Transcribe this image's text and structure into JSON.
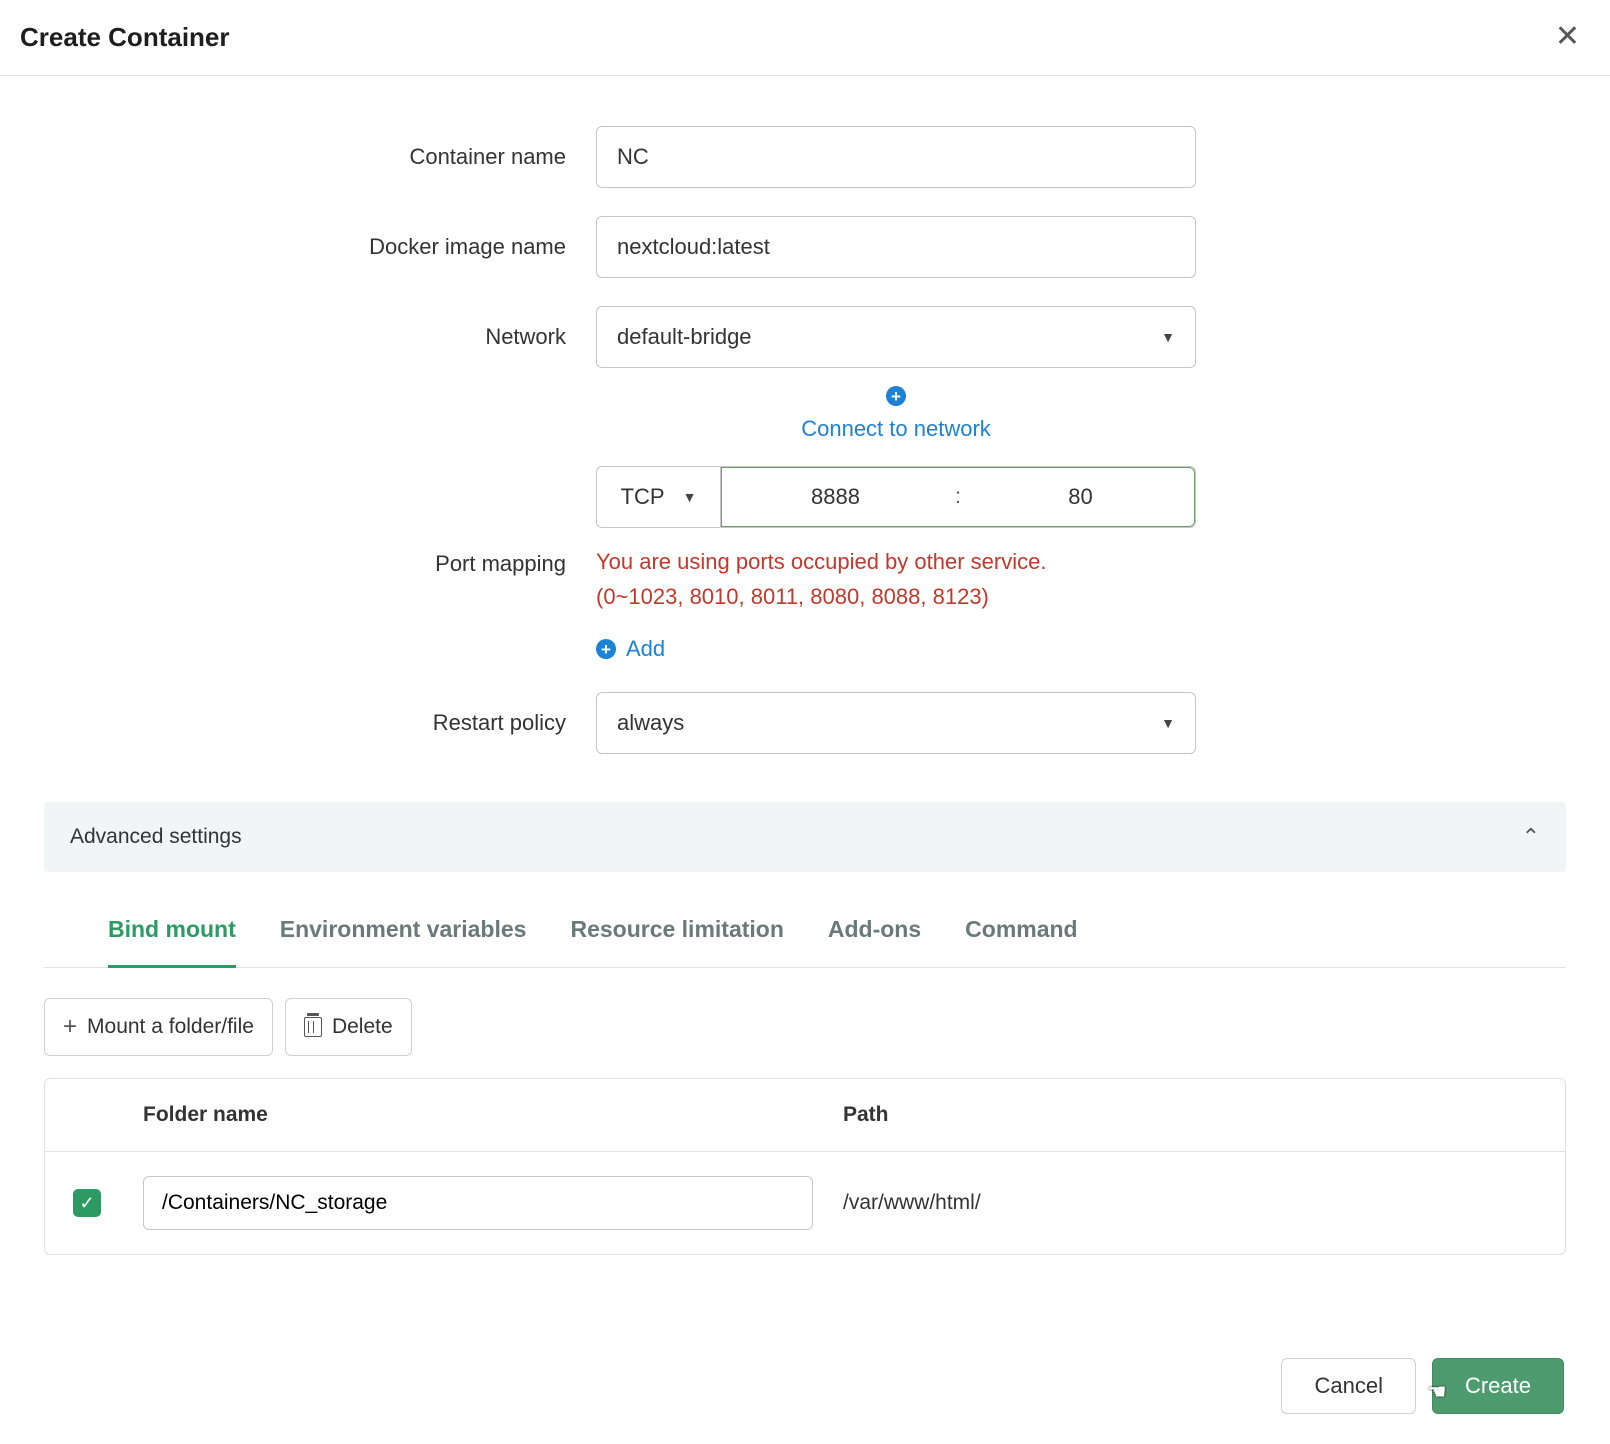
{
  "dialog": {
    "title": "Create Container"
  },
  "form": {
    "container_name": {
      "label": "Container name",
      "value": "NC"
    },
    "docker_image": {
      "label": "Docker image name",
      "value": "nextcloud:latest"
    },
    "network": {
      "label": "Network",
      "value": "default-bridge",
      "connect_link": "Connect to network"
    },
    "port_mapping": {
      "label": "Port mapping",
      "protocol": "TCP",
      "host_port": "8888",
      "container_port": "80",
      "warning_line1": "You are using ports occupied by other service.",
      "warning_line2": "(0~1023, 8010, 8011, 8080, 8088, 8123)",
      "add_link": "Add"
    },
    "restart_policy": {
      "label": "Restart policy",
      "value": "always"
    }
  },
  "advanced": {
    "title": "Advanced settings"
  },
  "tabs": {
    "bind_mount": "Bind mount",
    "env_vars": "Environment variables",
    "resource": "Resource limitation",
    "addons": "Add-ons",
    "command": "Command"
  },
  "bind_actions": {
    "mount": "Mount a folder/file",
    "delete": "Delete"
  },
  "bind_table": {
    "col_folder": "Folder name",
    "col_path": "Path",
    "rows": [
      {
        "folder": "/Containers/NC_storage",
        "path": "/var/www/html/"
      }
    ]
  },
  "footer": {
    "cancel": "Cancel",
    "create": "Create"
  }
}
